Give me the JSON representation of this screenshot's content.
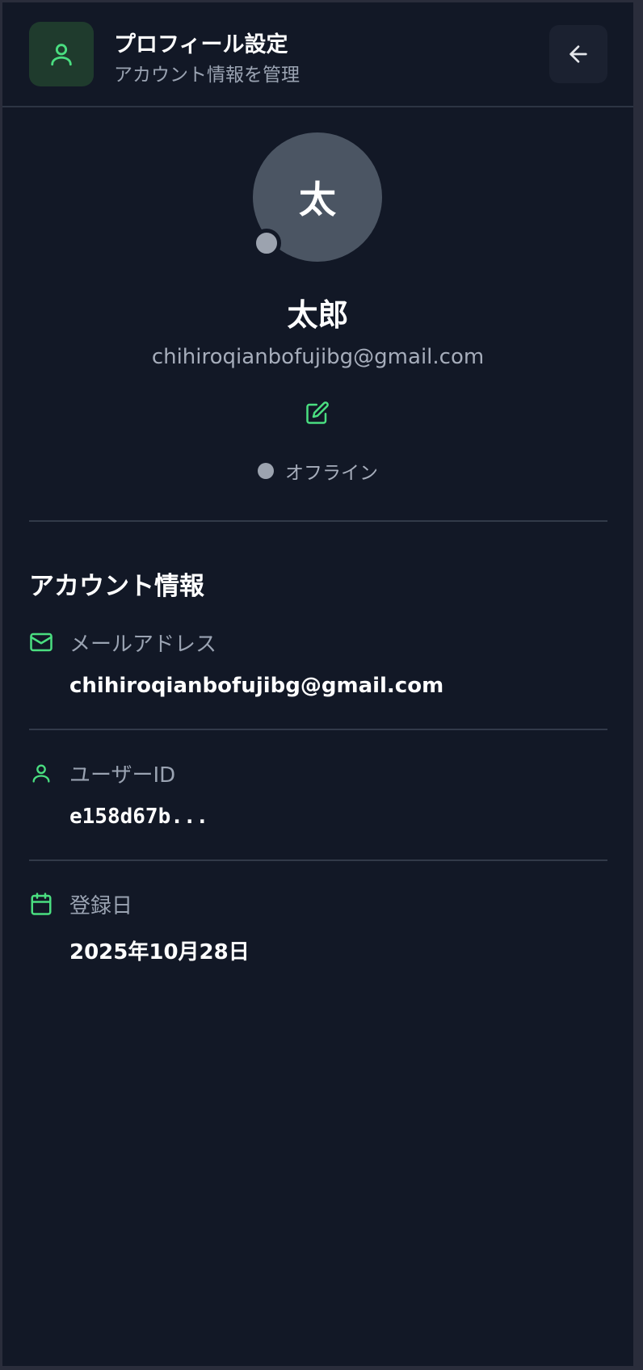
{
  "header": {
    "title": "プロフィール設定",
    "subtitle": "アカウント情報を管理",
    "icon": "user-icon",
    "back_icon": "arrow-left-icon"
  },
  "profile": {
    "avatar_initial": "太",
    "name": "太郎",
    "email": "chihiroqianbofujibg@gmail.com",
    "edit_icon": "edit-icon",
    "status": "オフライン"
  },
  "account": {
    "section_title": "アカウント情報",
    "rows": [
      {
        "icon": "mail-icon",
        "label": "メールアドレス",
        "value": "chihiroqianbofujibg@gmail.com"
      },
      {
        "icon": "user-icon",
        "label": "ユーザーID",
        "value": "e158d67b..."
      },
      {
        "icon": "calendar-icon",
        "label": "登録日",
        "value": "2025年10月28日"
      }
    ]
  },
  "colors": {
    "background": "#121826",
    "accent": "#4ade80",
    "muted_text": "#9aa3b2",
    "offline": "#9ca3af",
    "avatar_bg": "#4b5563"
  }
}
